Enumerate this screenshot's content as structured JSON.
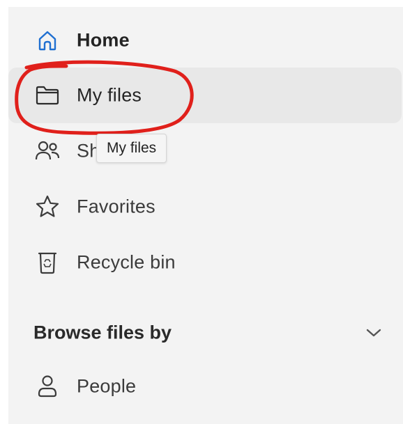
{
  "nav": {
    "items": [
      {
        "label": "Home",
        "icon": "home-icon"
      },
      {
        "label": "My files",
        "icon": "folder-icon"
      },
      {
        "label": "Shared",
        "icon": "people-icon"
      },
      {
        "label": "Favorites",
        "icon": "star-icon"
      },
      {
        "label": "Recycle bin",
        "icon": "recycle-bin-icon"
      }
    ]
  },
  "tooltip": {
    "text": "My files"
  },
  "browse": {
    "title": "Browse files by",
    "chevron_icon": "chevron-down-icon",
    "items": [
      {
        "label": "People",
        "icon": "person-icon"
      }
    ]
  },
  "colors": {
    "panel_bg": "#f3f3f3",
    "selected_bg": "#e8e8e8",
    "home_icon": "#1f6fd1",
    "annotation": "#e0201b"
  }
}
